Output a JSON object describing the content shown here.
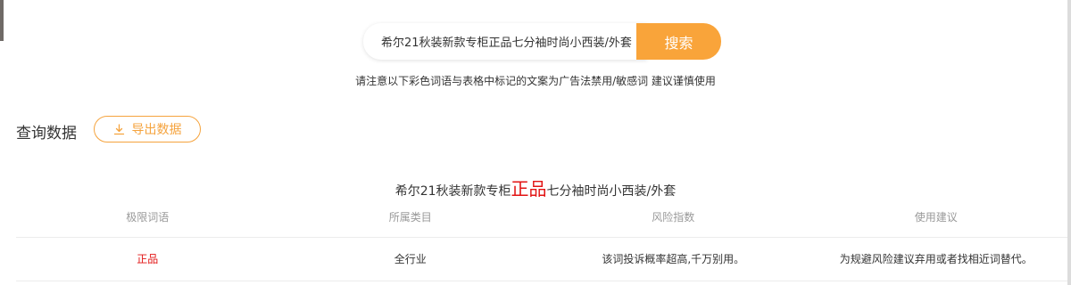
{
  "search": {
    "query": "希尔21秋装新款专柜正品七分袖时尚小西装/外套",
    "button_label": "搜索"
  },
  "notice": "请注意以下彩色词语与表格中标记的文案为广告法禁用/敏感词 建议谨慎使用",
  "section": {
    "title": "查询数据",
    "export_label": "导出数据"
  },
  "result": {
    "title_before": "希尔21秋装新款专柜",
    "title_highlight": "正品",
    "title_after": "七分袖时尚小西装/外套",
    "highlight_color": "#e21414"
  },
  "table": {
    "headers": [
      "极限词语",
      "所属类目",
      "风险指数",
      "使用建议"
    ],
    "rows": [
      [
        "正品",
        "全行业",
        "该词投诉概率超高,千万别用。",
        "为规避风险建议弃用或者找相近词替代。"
      ]
    ]
  },
  "colors": {
    "accent": "#f9a43a",
    "warning": "#e21414"
  }
}
